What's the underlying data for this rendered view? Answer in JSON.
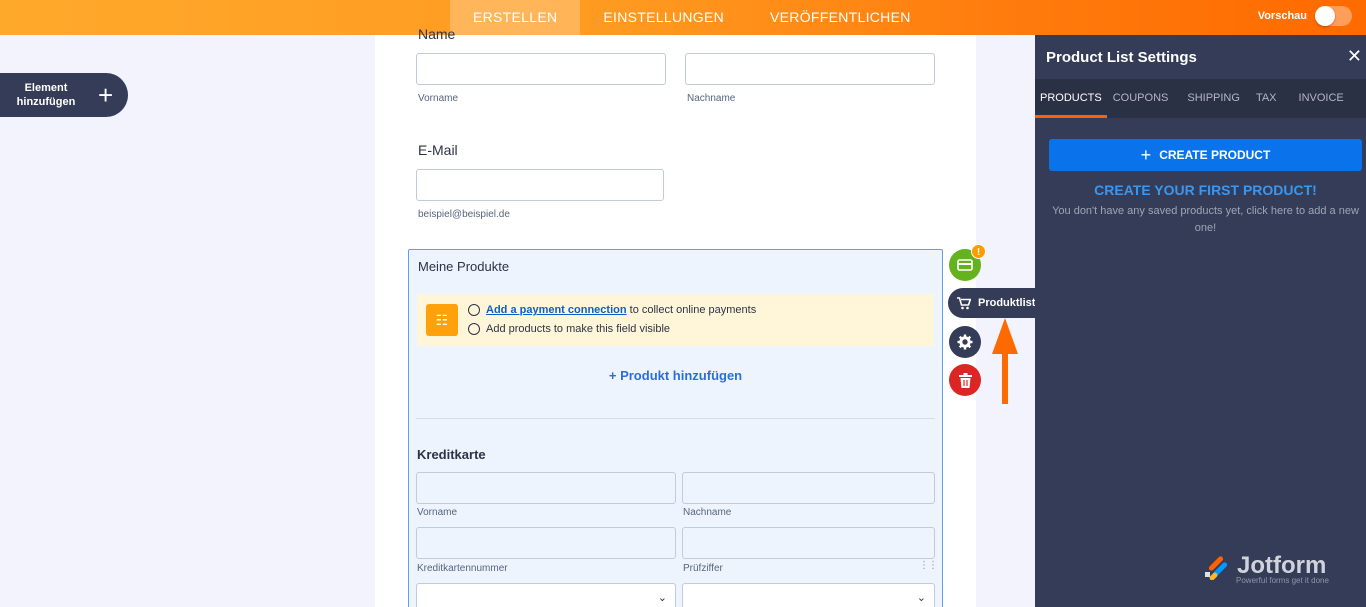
{
  "topbar": {
    "tabs": [
      {
        "label": "ERSTELLEN"
      },
      {
        "label": "EINSTELLUNGEN"
      },
      {
        "label": "VERÖFFENTLICHEN"
      }
    ],
    "preview_label": "Vorschau"
  },
  "add_element": {
    "label": "Element hinzufügen"
  },
  "form": {
    "name_label": "Name",
    "first_name_sublabel": "Vorname",
    "last_name_sublabel": "Nachname",
    "email_label": "E-Mail",
    "email_sublabel": "beispiel@beispiel.de",
    "product_field": {
      "title": "Meine Produkte",
      "notice_link": "Add a payment connection",
      "notice_line1_rest": " to collect online payments",
      "notice_line2": "Add products to make this field visible",
      "add_product": "+ Produkt hinzufügen",
      "credit_card_title": "Kreditkarte",
      "cc_first_name": "Vorname",
      "cc_last_name": "Nachname",
      "cc_number": "Kreditkartennummer",
      "cc_cvv": "Prüfziffer"
    }
  },
  "field_actions": {
    "badge": "!",
    "tooltip": "Produktlist"
  },
  "panel": {
    "title": "Product List Settings",
    "tabs": [
      {
        "label": "PRODUCTS"
      },
      {
        "label": "COUPONS"
      },
      {
        "label": "SHIPPING"
      },
      {
        "label": "TAX"
      },
      {
        "label": "INVOICE"
      }
    ],
    "create_button": "CREATE PRODUCT",
    "first_product": "CREATE YOUR FIRST PRODUCT!",
    "empty_text": "You don't have any saved products yet, click here to add a new one!",
    "brand": "Jotform",
    "brand_tagline": "Powerful forms get it done"
  },
  "colors": {
    "accent_orange": "#ff6100",
    "panel_bg": "#343c57",
    "primary_blue": "#0a73eb",
    "payment_green": "#64b21e",
    "delete_red": "#dc2626"
  }
}
